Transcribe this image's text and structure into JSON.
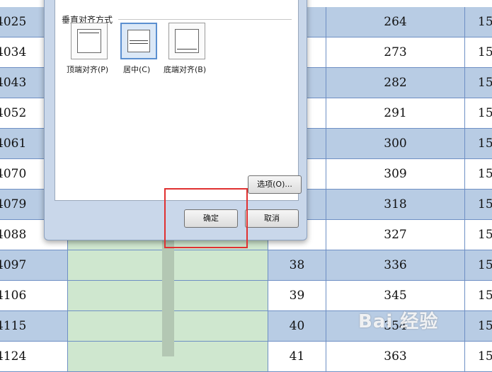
{
  "dialog": {
    "vertical_align_group": "垂直对齐方式",
    "options": [
      {
        "label": "顶端对齐(P)",
        "icon": "align-top-icon",
        "selected": false
      },
      {
        "label": "居中(C)",
        "icon": "align-middle-icon",
        "selected": true
      },
      {
        "label": "底端对齐(B)",
        "icon": "align-bottom-icon",
        "selected": false
      }
    ],
    "options_button": "选项(O)...",
    "ok_button": "确定",
    "cancel_button": "取消"
  },
  "table": {
    "rows": [
      {
        "a": "4025",
        "c": "",
        "d": "264",
        "e": "15",
        "band": true
      },
      {
        "a": "4034",
        "c": "",
        "d": "273",
        "e": "15",
        "band": false
      },
      {
        "a": "4043",
        "c": "",
        "d": "282",
        "e": "15",
        "band": true
      },
      {
        "a": "4052",
        "c": "",
        "d": "291",
        "e": "15",
        "band": false
      },
      {
        "a": "4061",
        "c": "",
        "d": "300",
        "e": "15",
        "band": true
      },
      {
        "a": "4070",
        "c": "",
        "d": "309",
        "e": "15",
        "band": false
      },
      {
        "a": "4079",
        "c": "",
        "d": "318",
        "e": "15",
        "band": true
      },
      {
        "a": "4088",
        "c": "",
        "d": "327",
        "e": "15",
        "band": false
      },
      {
        "a": "4097",
        "c": "38",
        "d": "336",
        "e": "15",
        "band": true
      },
      {
        "a": "4106",
        "c": "39",
        "d": "345",
        "e": "15",
        "band": false
      },
      {
        "a": "4115",
        "c": "40",
        "d": "354",
        "e": "15",
        "band": true
      },
      {
        "a": "4124",
        "c": "41",
        "d": "363",
        "e": "15",
        "band": false
      }
    ]
  },
  "watermark": {
    "text": "Bai 经验"
  },
  "colors": {
    "band": "#b8cce4",
    "green_column": "#cfe7cf",
    "highlight": "#e03030",
    "selected": "#5b8fd0"
  }
}
